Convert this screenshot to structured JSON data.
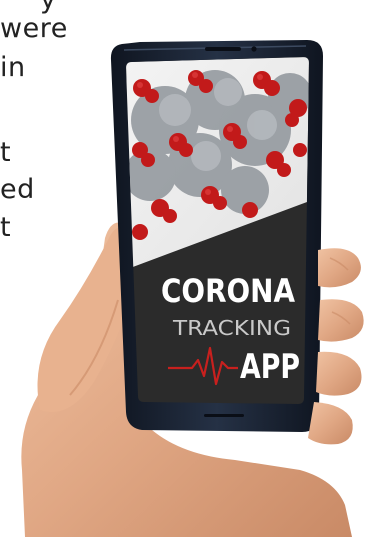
{
  "background_text": {
    "lines": [
      "y",
      "were",
      "in",
      "",
      "t",
      "ed",
      "t"
    ]
  },
  "phone_screen": {
    "title_line1": "CORONA",
    "title_line2": "TRACKING",
    "title_line3": "APP",
    "virus_image": "coronavirus-render",
    "heartbeat_icon": "ecg-pulse-icon"
  },
  "colors": {
    "phone_body": "#1c2533",
    "screen_dark": "#2b2b2b",
    "title_white": "#ffffff",
    "title_gray": "#c9c9c9",
    "heartbeat_red": "#c8201e",
    "virus_red": "#c21a1a",
    "skin": "#e0a784"
  }
}
